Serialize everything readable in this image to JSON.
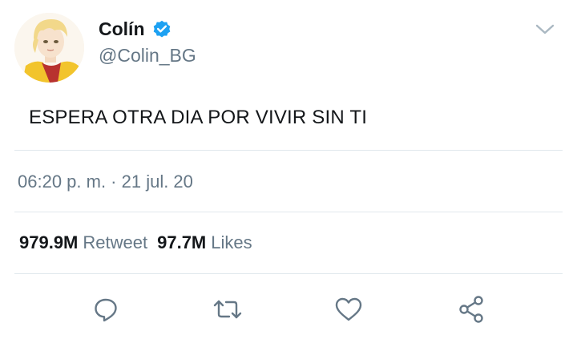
{
  "user": {
    "name": "Colín",
    "handle": "@Colin_BG",
    "verified_icon": "verified-badge-icon",
    "avatar_icon": "avatar-image"
  },
  "menu_icon": "chevron-down-icon",
  "tweet": {
    "text": "ESPERA OTRA DIA POR VIVIR SIN TI",
    "timestamp": "06:20 p. m. · 21 jul. 20"
  },
  "stats": {
    "retweet_count": "979.9M",
    "retweet_label": "Retweet",
    "likes_count": "97.7M",
    "likes_label": "Likes"
  },
  "actions": {
    "reply_icon": "reply-icon",
    "retweet_icon": "retweet-icon",
    "like_icon": "heart-icon",
    "share_icon": "share-icon"
  },
  "colors": {
    "verified_blue": "#1da1f2",
    "icon_gray": "#657786",
    "text_dark": "#14171a",
    "divider": "#e1e8ed"
  }
}
